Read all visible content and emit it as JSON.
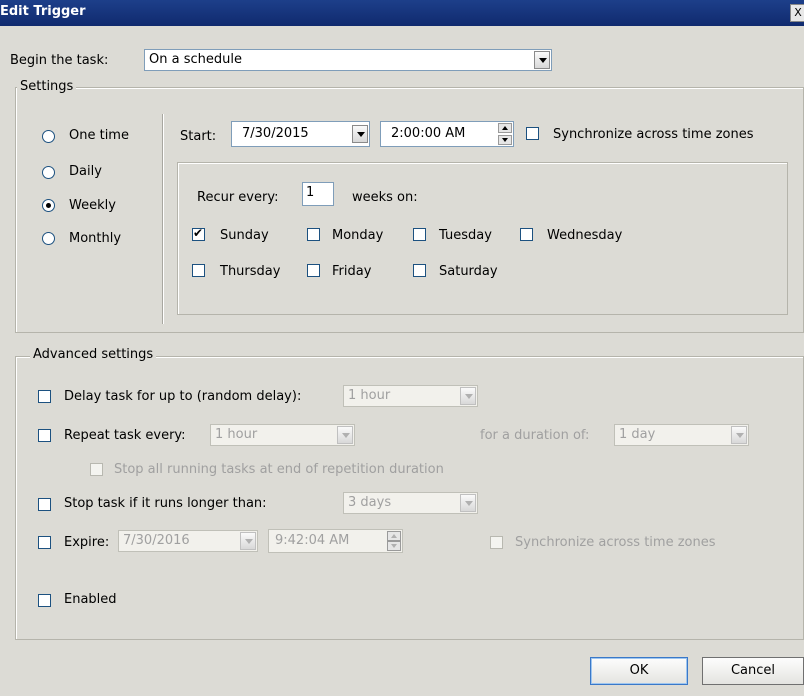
{
  "window": {
    "title": "Edit Trigger",
    "close_label": "X"
  },
  "begin": {
    "label": "Begin the task:",
    "value": "On a schedule"
  },
  "settings": {
    "group_label": "Settings",
    "frequency": [
      {
        "label": "One time",
        "selected": false
      },
      {
        "label": "Daily",
        "selected": false
      },
      {
        "label": "Weekly",
        "selected": true
      },
      {
        "label": "Monthly",
        "selected": false
      }
    ],
    "start_label": "Start:",
    "start_date": "7/30/2015",
    "start_time": "2:00:00 AM",
    "sync_label": "Synchronize across time zones",
    "sync_checked": false,
    "recur_label": "Recur every:",
    "recur_value": "1",
    "weeks_on_label": "weeks on:",
    "days": [
      {
        "label": "Sunday",
        "checked": true
      },
      {
        "label": "Monday",
        "checked": false
      },
      {
        "label": "Tuesday",
        "checked": false
      },
      {
        "label": "Wednesday",
        "checked": false
      },
      {
        "label": "Thursday",
        "checked": false
      },
      {
        "label": "Friday",
        "checked": false
      },
      {
        "label": "Saturday",
        "checked": false
      }
    ]
  },
  "advanced": {
    "group_label": "Advanced settings",
    "delay_label": "Delay task for up to (random delay):",
    "delay_value": "1 hour",
    "repeat_label": "Repeat task every:",
    "repeat_value": "1 hour",
    "duration_label": "for a duration of:",
    "duration_value": "1 day",
    "stop_all_label": "Stop all running tasks at end of repetition duration",
    "stop_longer_label": "Stop task if it runs longer than:",
    "stop_longer_value": "3 days",
    "expire_label": "Expire:",
    "expire_date": "7/30/2016",
    "expire_time": "9:42:04 AM",
    "expire_sync_label": "Synchronize across time zones",
    "enabled_label": "Enabled"
  },
  "buttons": {
    "ok": "OK",
    "cancel": "Cancel"
  }
}
